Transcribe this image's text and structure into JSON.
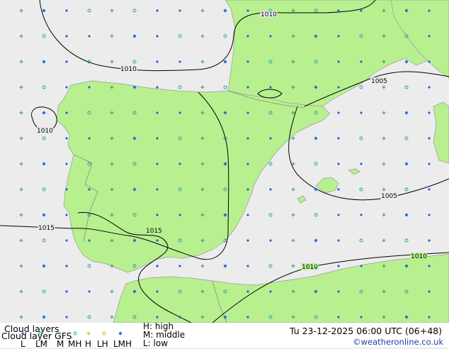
{
  "map": {
    "isobars": [
      {
        "label": "1010"
      },
      {
        "label": "1010"
      },
      {
        "label": "1010"
      },
      {
        "label": "1015"
      },
      {
        "label": "1015"
      },
      {
        "label": "1005"
      },
      {
        "label": "1005"
      },
      {
        "label": "1010"
      },
      {
        "label": "1010"
      }
    ]
  },
  "footer": {
    "title_line1": "Cloud layers",
    "title_line2": "Cloud layer GFS",
    "legend": {
      "codes": [
        "L",
        "LM",
        "M",
        "MH",
        "H",
        "LH",
        "LMH"
      ],
      "symbol_colors": {
        "L": "#1e5fd8",
        "LM": "#1a9a9a",
        "M": "#1aa04a",
        "MH": "#1a9ab8",
        "H": "#e49b1a",
        "LH": "#e49b1a",
        "LMH": "#1e6fe0"
      },
      "levels": [
        "H: high",
        "M: middle",
        "L: low"
      ]
    },
    "datetime": "Tu 23-12-2025 06:00 UTC (06+48)",
    "credit": "©weatheronline.co.uk"
  },
  "colors": {
    "sea": "#ececec",
    "land": "#b8f090",
    "border": "#888888",
    "isobar": "#000000"
  }
}
